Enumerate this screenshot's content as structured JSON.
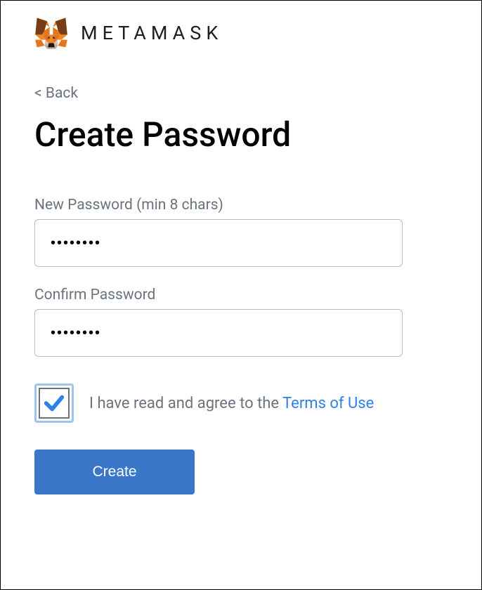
{
  "header": {
    "brand": "METAMASK"
  },
  "nav": {
    "back_label": "< Back"
  },
  "page": {
    "title": "Create Password"
  },
  "form": {
    "new_password": {
      "label": "New Password (min 8 chars)",
      "value": "••••••••"
    },
    "confirm_password": {
      "label": "Confirm Password",
      "value": "••••••••"
    },
    "terms": {
      "prefix": "I have read and agree to the ",
      "link": "Terms of Use"
    },
    "submit_label": "Create"
  }
}
